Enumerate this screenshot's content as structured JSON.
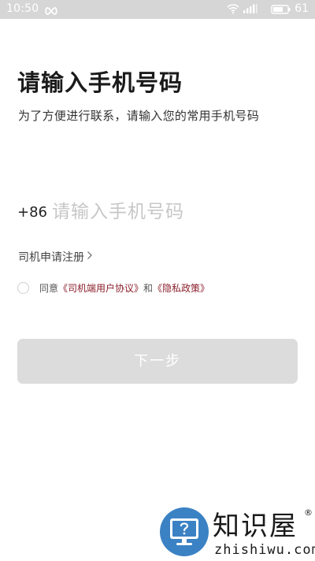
{
  "status_bar": {
    "time": "10:50",
    "battery_level": "61",
    "icons": [
      "infinity-icon",
      "wifi-icon",
      "signal-icon",
      "battery-icon"
    ],
    "background": "#d6d6d6"
  },
  "header": {
    "title": "请输入手机号码",
    "subtitle": "为了方便进行联系，请输入您的常用手机号码"
  },
  "phone": {
    "country_code": "+86",
    "placeholder": "请输入手机号码",
    "value": ""
  },
  "driver_register": {
    "label": "司机申请注册",
    "icon": "chevron-right-icon"
  },
  "agreement": {
    "checked": false,
    "prefix": "同意",
    "link_user_agreement": "《司机端用户协议》",
    "conjunction": "和",
    "link_privacy_policy": "《隐私政策》",
    "link_color": "#8a1f2b"
  },
  "next_button": {
    "label": "下一步",
    "enabled": false,
    "background": "#dcdcdc"
  },
  "watermark": {
    "name": "知识屋",
    "registered_mark": "®",
    "domain": "zhishiwu.com",
    "logo_color": "#3b82c4"
  }
}
